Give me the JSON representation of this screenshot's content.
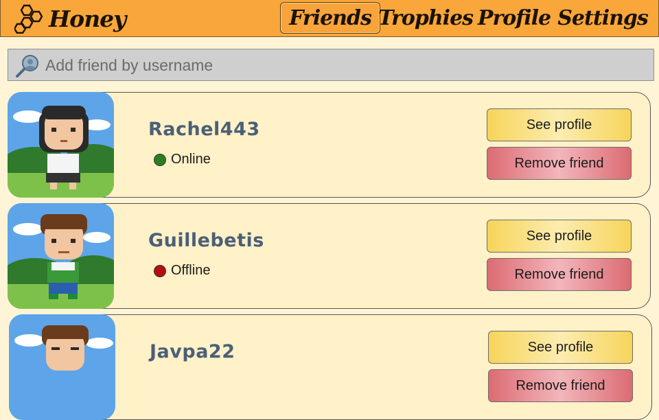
{
  "header": {
    "app_name": "Honey",
    "nav": [
      "Friends",
      "Trophies",
      "Profile",
      "Settings"
    ],
    "active_nav": "Friends",
    "accent": "#f9a63a"
  },
  "search": {
    "placeholder": "Add friend by username",
    "value": ""
  },
  "friends": [
    {
      "username": "Rachel443",
      "status": "Online",
      "status_color": "#2f7d1f",
      "avatar": "girl-dark-hair-avatar",
      "profile_label": "See profile",
      "remove_label": "Remove friend"
    },
    {
      "username": "Guillebetis",
      "status": "Offline",
      "status_color": "#b40f0f",
      "avatar": "boy-brown-hair-avatar",
      "profile_label": "See profile",
      "remove_label": "Remove friend"
    },
    {
      "username": "Javpa22",
      "status": "",
      "status_color": "",
      "avatar": "boy-brown-hair-avatar",
      "profile_label": "See profile",
      "remove_label": "Remove friend"
    }
  ]
}
